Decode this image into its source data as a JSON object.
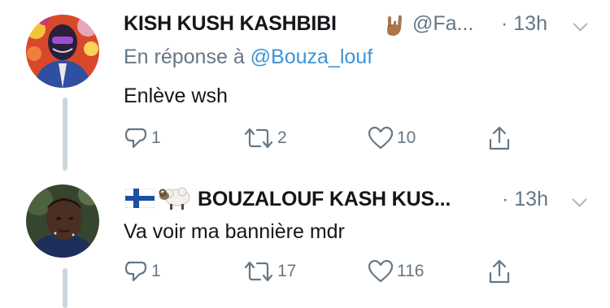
{
  "tweets": [
    {
      "display_name": "KISH KUSH KASHBIBI",
      "handle": "@Fa...",
      "time": "· 13h",
      "reply_prefix": "En réponse à ",
      "reply_handle": "@Bouza_louf",
      "text": "Enlève wsh",
      "reply_count": "1",
      "retweet_count": "2",
      "like_count": "10"
    },
    {
      "display_name": "BOUZALOUF KASH KUS...",
      "time": "· 13h",
      "text": "Va voir ma bannière mdr",
      "reply_count": "1",
      "retweet_count": "17",
      "like_count": "116"
    }
  ],
  "colors": {
    "text": "#14171a",
    "secondary": "#657786",
    "link": "#3b94d9",
    "thread_line": "#ccd6dd"
  },
  "icons": [
    "reply-icon",
    "retweet-icon",
    "like-icon",
    "share-icon",
    "caret-down-icon",
    "rock-on-hand-emoji",
    "finland-flag-emoji",
    "sheep-emoji"
  ]
}
